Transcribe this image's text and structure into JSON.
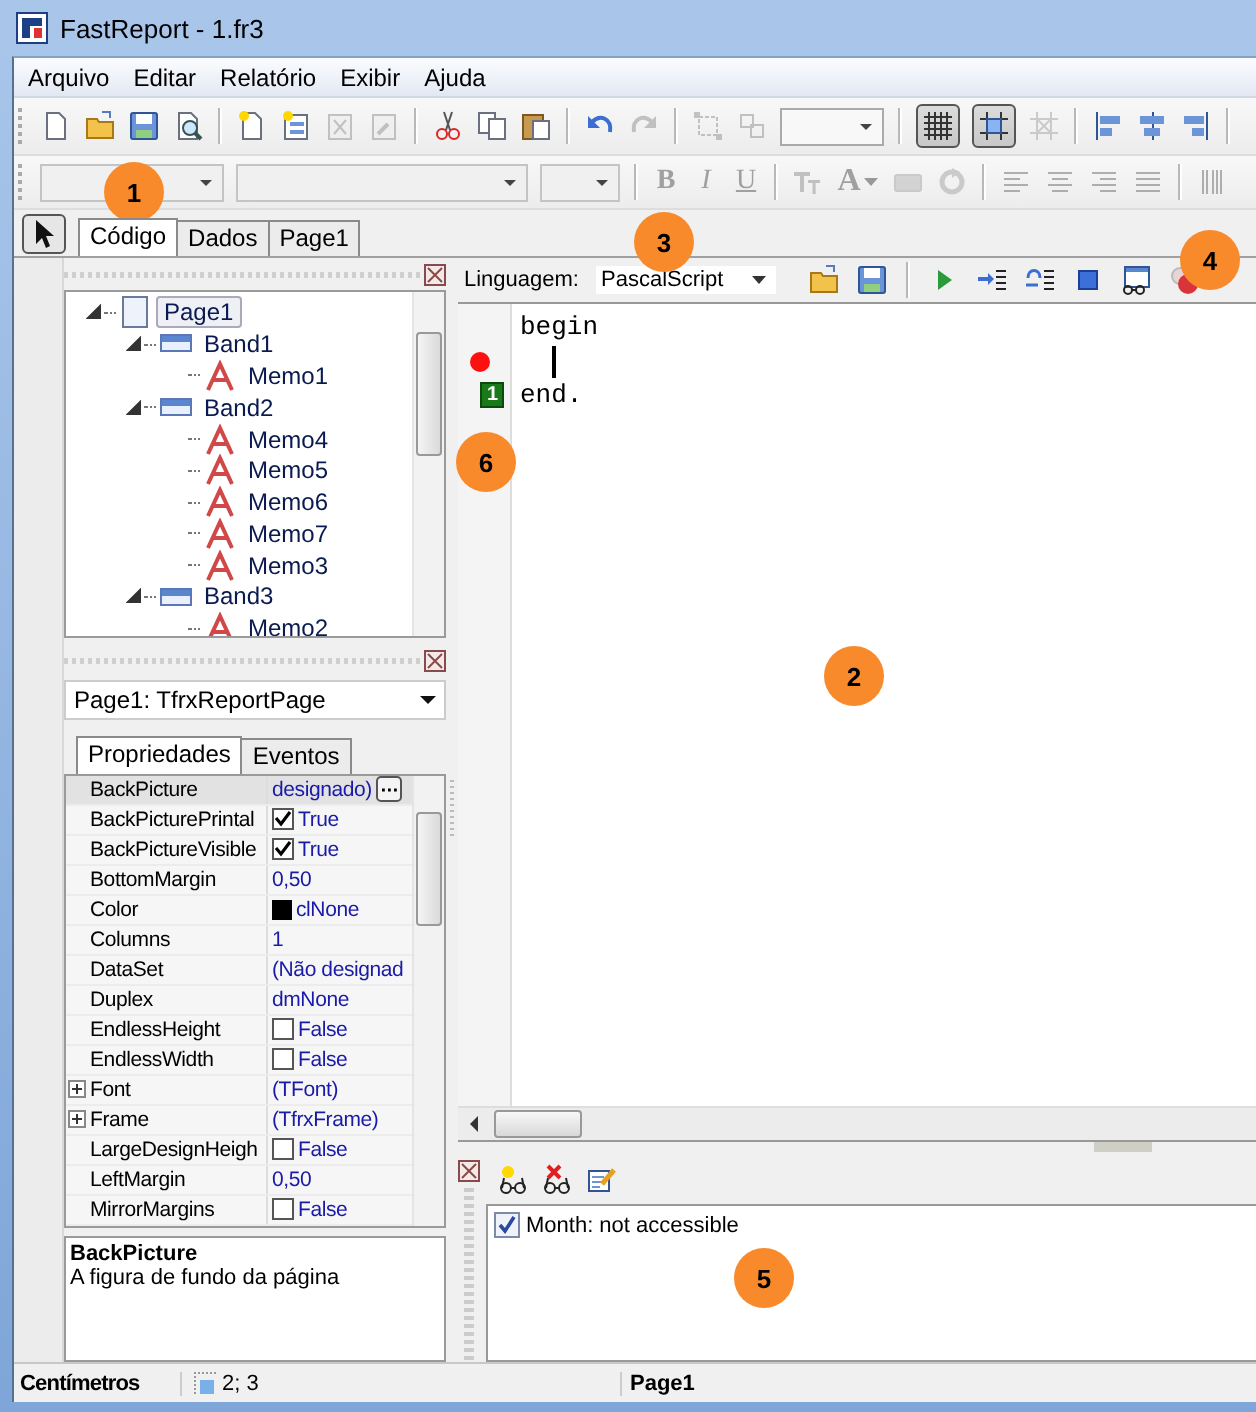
{
  "window": {
    "title": "FastReport - 1.fr3"
  },
  "menu": [
    "Arquivo",
    "Editar",
    "Relatório",
    "Exibir",
    "Ajuda"
  ],
  "toolbar_1": [
    {
      "kind": "new",
      "disabled": false,
      "pressed": false
    },
    {
      "kind": "open",
      "disabled": false,
      "pressed": false
    },
    {
      "kind": "save",
      "disabled": false,
      "pressed": false
    },
    {
      "kind": "preview",
      "disabled": false,
      "pressed": false
    },
    {
      "kind": "separator"
    },
    {
      "kind": "new-page",
      "disabled": false,
      "pressed": false
    },
    {
      "kind": "new-dialog",
      "disabled": false,
      "pressed": false
    },
    {
      "kind": "delete-page",
      "disabled": true,
      "pressed": false
    },
    {
      "kind": "page-settings",
      "disabled": true,
      "pressed": false
    },
    {
      "kind": "separator"
    },
    {
      "kind": "cut",
      "disabled": false,
      "pressed": false
    },
    {
      "kind": "copy",
      "disabled": false,
      "pressed": false
    },
    {
      "kind": "paste",
      "disabled": false,
      "pressed": false
    },
    {
      "kind": "separator"
    },
    {
      "kind": "undo",
      "disabled": false,
      "pressed": false
    },
    {
      "kind": "redo",
      "disabled": true,
      "pressed": false
    },
    {
      "kind": "separator"
    },
    {
      "kind": "group",
      "disabled": true,
      "pressed": false
    },
    {
      "kind": "ungroup",
      "disabled": true,
      "pressed": false
    },
    {
      "kind": "zoom-combo",
      "disabled": false
    },
    {
      "kind": "separator"
    },
    {
      "kind": "grid",
      "disabled": false,
      "pressed": true
    },
    {
      "kind": "snap",
      "disabled": false,
      "pressed": true
    },
    {
      "kind": "fit",
      "disabled": true,
      "pressed": false
    },
    {
      "kind": "separator"
    },
    {
      "kind": "align-left",
      "disabled": false,
      "pressed": false
    },
    {
      "kind": "align-center",
      "disabled": false,
      "pressed": false
    },
    {
      "kind": "align-right",
      "disabled": false,
      "pressed": false
    },
    {
      "kind": "separator"
    }
  ],
  "toolbar_2": [
    {
      "kind": "style-combo",
      "disabled": true
    },
    {
      "kind": "font-combo",
      "disabled": true
    },
    {
      "kind": "size-combo",
      "disabled": true
    },
    {
      "kind": "separator"
    },
    {
      "kind": "bold",
      "label": "B",
      "disabled": true
    },
    {
      "kind": "italic",
      "label": "I",
      "disabled": true
    },
    {
      "kind": "underline",
      "label": "U",
      "disabled": true
    },
    {
      "kind": "separator"
    },
    {
      "kind": "font-size",
      "disabled": true
    },
    {
      "kind": "font-color",
      "label": "A",
      "disabled": true
    },
    {
      "kind": "highlight",
      "disabled": true
    },
    {
      "kind": "rotate",
      "disabled": true
    },
    {
      "kind": "separator"
    },
    {
      "kind": "text-left",
      "disabled": true
    },
    {
      "kind": "text-center",
      "disabled": true
    },
    {
      "kind": "text-right",
      "disabled": true
    },
    {
      "kind": "text-justify",
      "disabled": true
    },
    {
      "kind": "separator"
    },
    {
      "kind": "barcode",
      "disabled": true
    }
  ],
  "page_tabs": [
    {
      "label": "Código",
      "selected": true
    },
    {
      "label": "Dados",
      "selected": false
    },
    {
      "label": "Page1",
      "selected": false
    }
  ],
  "tree": [
    {
      "label": "Page1",
      "kind": "page",
      "expanded": true,
      "selected": true,
      "children": [
        {
          "label": "Band1",
          "kind": "band",
          "expanded": true,
          "selected": false,
          "children": [
            {
              "label": "Memo1",
              "kind": "memo",
              "selected": false
            }
          ]
        },
        {
          "label": "Band2",
          "kind": "band",
          "expanded": true,
          "selected": false,
          "children": [
            {
              "label": "Memo4",
              "kind": "memo",
              "selected": false
            },
            {
              "label": "Memo5",
              "kind": "memo",
              "selected": false
            },
            {
              "label": "Memo6",
              "kind": "memo",
              "selected": false
            },
            {
              "label": "Memo7",
              "kind": "memo",
              "selected": false
            },
            {
              "label": "Memo3",
              "kind": "memo",
              "selected": false
            }
          ]
        },
        {
          "label": "Band3",
          "kind": "band",
          "expanded": true,
          "selected": false,
          "children": [
            {
              "label": "Memo2",
              "kind": "memo",
              "selected": false
            }
          ]
        }
      ]
    }
  ],
  "object_selector": {
    "value": "Page1: TfrxReportPage"
  },
  "inspector_tabs": [
    {
      "label": "Propriedades",
      "selected": true
    },
    {
      "label": "Eventos",
      "selected": false
    }
  ],
  "properties": [
    {
      "name": "BackPicture",
      "kind": "button",
      "value": "designado)",
      "selected": true
    },
    {
      "name": "BackPicturePrintal",
      "kind": "checkbox",
      "checked": true,
      "value": "True",
      "selected": false
    },
    {
      "name": "BackPictureVisible",
      "kind": "checkbox",
      "checked": true,
      "value": "True",
      "selected": false
    },
    {
      "name": "BottomMargin",
      "kind": "text",
      "value": "0,50",
      "selected": false
    },
    {
      "name": "Color",
      "kind": "color",
      "color": "#000000",
      "value": "clNone",
      "selected": false
    },
    {
      "name": "Columns",
      "kind": "text",
      "value": "1",
      "selected": false
    },
    {
      "name": "DataSet",
      "kind": "text",
      "value": "(Não designad",
      "selected": false
    },
    {
      "name": "Duplex",
      "kind": "text",
      "value": "dmNone",
      "selected": false
    },
    {
      "name": "EndlessHeight",
      "kind": "checkbox",
      "checked": false,
      "value": "False",
      "selected": false
    },
    {
      "name": "EndlessWidth",
      "kind": "checkbox",
      "checked": false,
      "value": "False",
      "selected": false
    },
    {
      "name": "Font",
      "kind": "group",
      "expanded": false,
      "value": "(TFont)",
      "selected": false
    },
    {
      "name": "Frame",
      "kind": "group",
      "expanded": false,
      "value": "(TfrxFrame)",
      "selected": false
    },
    {
      "name": "LargeDesignHeigh",
      "kind": "checkbox",
      "checked": false,
      "value": "False",
      "selected": false
    },
    {
      "name": "LeftMargin",
      "kind": "text",
      "value": "0,50",
      "selected": false
    },
    {
      "name": "MirrorMargins",
      "kind": "checkbox",
      "checked": false,
      "value": "False",
      "selected": false
    }
  ],
  "description": {
    "title": "BackPicture",
    "text": "A figura de fundo da página"
  },
  "code_toolbar": {
    "label": "Linguagem:",
    "language": "PascalScript",
    "tools": [
      {
        "kind": "open"
      },
      {
        "kind": "save"
      },
      {
        "kind": "separator"
      },
      {
        "kind": "run"
      },
      {
        "kind": "step-into"
      },
      {
        "kind": "step-over"
      },
      {
        "kind": "stop"
      },
      {
        "kind": "evaluate"
      },
      {
        "kind": "breakpoint"
      }
    ]
  },
  "code": [
    {
      "text": "begin",
      "breakpoint": false,
      "caret": false
    },
    {
      "breakpoint": true,
      "caret": true
    },
    {
      "text": "end.",
      "breakpoint": false,
      "caret": false,
      "bookmark": "1"
    }
  ],
  "watch_tools": [
    {
      "kind": "add-watch"
    },
    {
      "kind": "delete-watch"
    },
    {
      "kind": "edit-watch"
    }
  ],
  "watches": [
    {
      "text": "Month: not accessible",
      "checked": true
    }
  ],
  "status_bar": {
    "units": "Centímetros",
    "position": "2; 3",
    "page": "Page1"
  },
  "callouts": [
    "1",
    "2",
    "3",
    "4",
    "5",
    "6"
  ]
}
